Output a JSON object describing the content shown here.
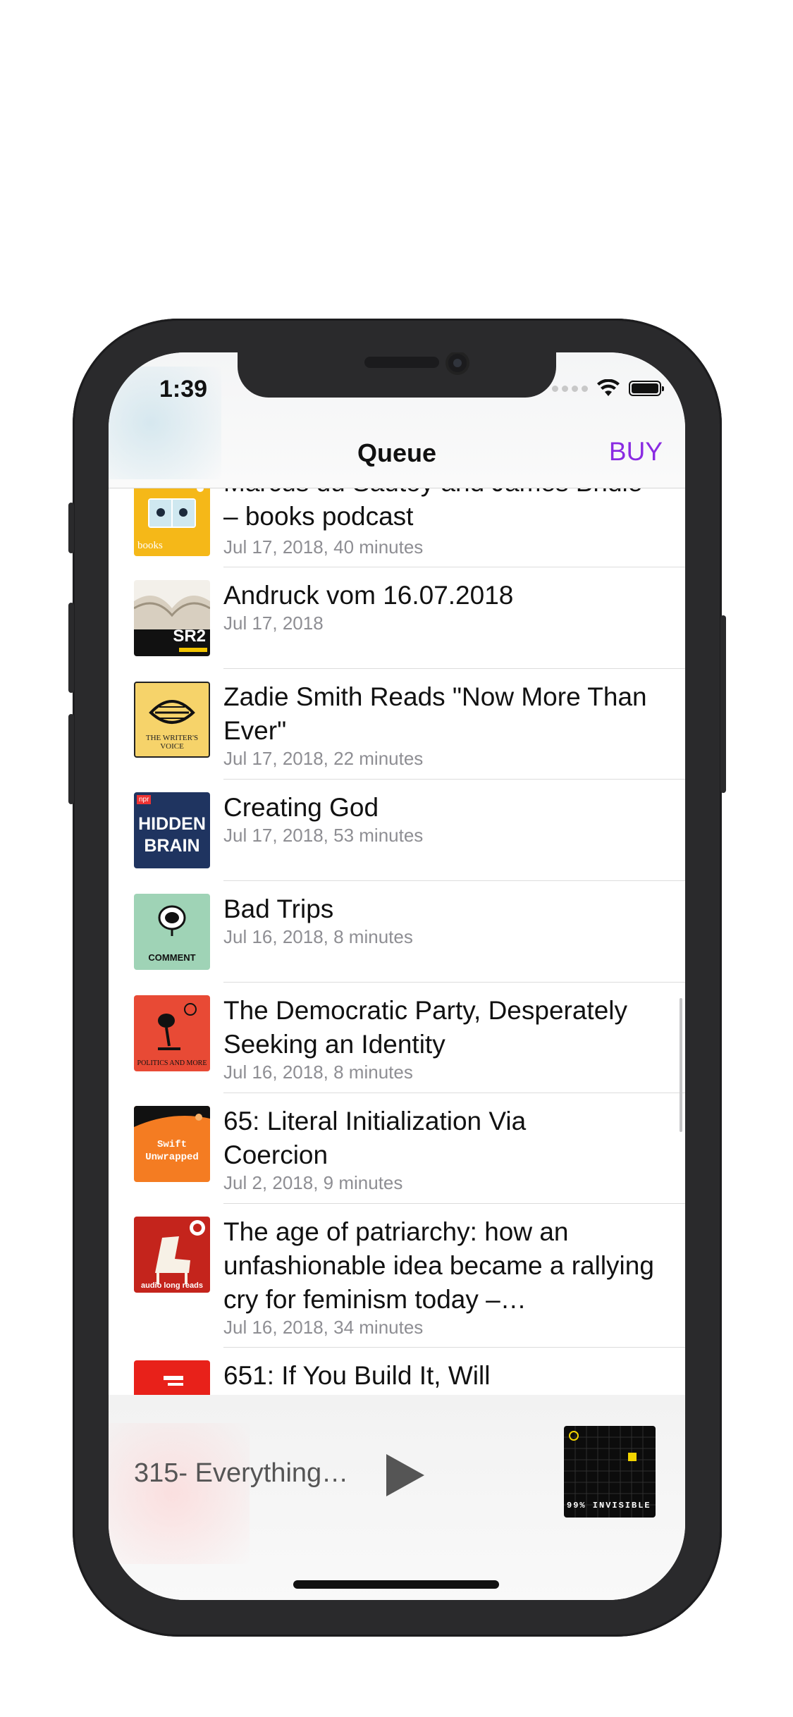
{
  "status": {
    "time": "1:39"
  },
  "nav": {
    "title": "Queue",
    "buy": "BUY"
  },
  "episodes": [
    {
      "title": "Marcus du Sautoy and James Bridle – books podcast",
      "date": "Jul 17, 2018, 40 minutes",
      "art": "guardian-books-podcast",
      "art_text": "books"
    },
    {
      "title": "Andruck vom 16.07.2018",
      "date": "Jul 17, 2018",
      "art": "sr2-podcast",
      "art_text": "SR2"
    },
    {
      "title": "Zadie Smith Reads \"Now More Than Ever\"",
      "date": "Jul 17, 2018, 22 minutes",
      "art": "the-writers-voice",
      "art_text": "THE WRITER'S VOICE"
    },
    {
      "title": "Creating God",
      "date": "Jul 17, 2018, 53 minutes",
      "art": "hidden-brain",
      "art_text": "HIDDEN BRAIN"
    },
    {
      "title": "Bad Trips",
      "date": "Jul 16, 2018, 8 minutes",
      "art": "new-yorker-comment",
      "art_text": "COMMENT"
    },
    {
      "title": "The Democratic Party, Desperately Seeking an Identity",
      "date": "Jul 16, 2018, 8 minutes",
      "art": "politics-and-more",
      "art_text": "POLITICS AND MORE"
    },
    {
      "title": "65: Literal Initialization Via Coercion",
      "date": "Jul 2, 2018, 9 minutes",
      "art": "swift-unwrapped",
      "art_text": "Swift Unwrapped"
    },
    {
      "title": "The age of patriarchy: how an unfashionable idea became a rallying cry for feminism today –…",
      "date": "Jul 16, 2018, 34 minutes",
      "art": "audio-long-reads",
      "art_text": "audio long reads"
    },
    {
      "title": "651: If You Build It, Will",
      "date": "",
      "art": "red-podcast",
      "art_text": ""
    }
  ],
  "player": {
    "title": "315- Everything…",
    "art": "99-percent-invisible",
    "art_text": "99% INVISIBLE"
  },
  "colors": {
    "accent": "#8a2be2"
  }
}
